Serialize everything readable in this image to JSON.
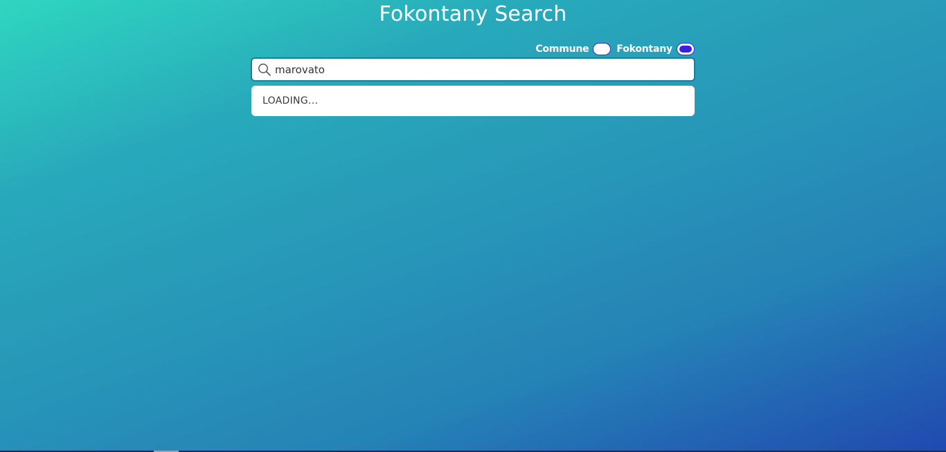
{
  "page": {
    "title": "Fokontany Search"
  },
  "toggles": [
    {
      "label": "Commune",
      "checked": false
    },
    {
      "label": "Fokontany",
      "checked": true
    }
  ],
  "search": {
    "value": "marovato",
    "placeholder": "",
    "icon": "search-icon"
  },
  "results": {
    "status": "LOADING..."
  },
  "colors": {
    "gradient_top_right": "#2fd6c0",
    "gradient_bottom_left": "#2049b0",
    "toggle_on": "#3a1fe0",
    "search_border": "#1f7c96"
  }
}
